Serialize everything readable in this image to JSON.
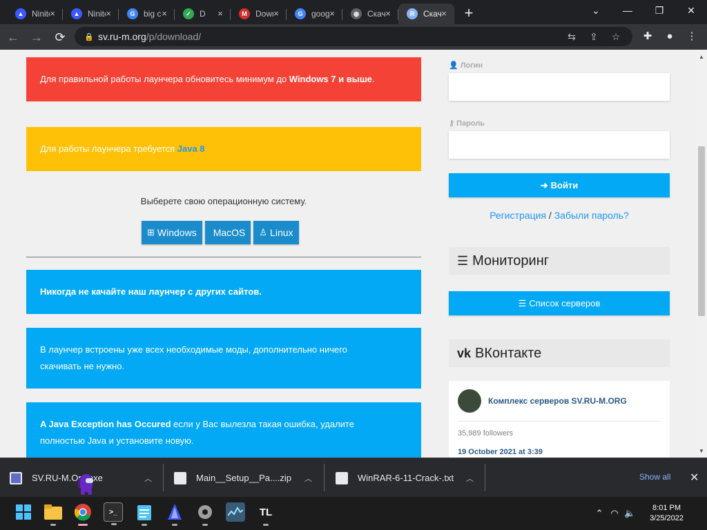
{
  "browser": {
    "tabs": [
      {
        "label": "Ninite",
        "favicon": "ninite-icon",
        "color": "#3d5afe",
        "active": false
      },
      {
        "label": "Ninite",
        "favicon": "ninite-icon",
        "color": "#3d5afe",
        "active": false
      },
      {
        "label": "big ch",
        "favicon": "google-icon",
        "color": "#4285f4",
        "active": false
      },
      {
        "label": "D",
        "favicon": "checkbox-icon",
        "color": "#34a853",
        "active": false
      },
      {
        "label": "Down",
        "favicon": "m-icon",
        "color": "#d32f2f",
        "active": false
      },
      {
        "label": "goog",
        "favicon": "google-icon",
        "color": "#4285f4",
        "active": false
      },
      {
        "label": "Скача",
        "favicon": "globe-icon",
        "color": "#5f6368",
        "active": false
      },
      {
        "label": "Скача",
        "favicon": "r-icon",
        "color": "#8ab4f8",
        "active": true
      }
    ],
    "url_host": "sv.ru-m.org",
    "url_path": "/p/download/"
  },
  "main": {
    "alert_red": {
      "text_before": "Для правильной работы лаунчера обновитесь минимум до ",
      "bold": "Windows 7 и выше",
      "text_after": "."
    },
    "alert_yellow": {
      "text_before": "Для работы лаунчера требуется ",
      "link": "Java 8"
    },
    "os_prompt": "Выберете свою операционную систему.",
    "os_buttons": [
      {
        "label": "Windows",
        "icon": "windows-icon"
      },
      {
        "label": "MacOS",
        "icon": "apple-icon"
      },
      {
        "label": "Linux",
        "icon": "linux-icon"
      }
    ],
    "notice1": "Никогда не качайте наш лаунчер с других сайтов.",
    "notice2_line1": "В лаунчер встроены уже всех необходимые моды, дополнительно ничего",
    "notice2_line2": "скачивать не нужно.",
    "notice3_bold": "A Java Exception has Occured",
    "notice3_line1": " если у Вас вылезла такая ошибка, удалите",
    "notice3_line2": "полностью Java и установите новую."
  },
  "sidebar": {
    "login_label": "Логин",
    "password_label": "Пароль",
    "login_button": "Войти",
    "register_link": "Регистрация",
    "separator": " / ",
    "forgot_link": "Забыли пароль?",
    "monitoring_title": "Мониторинг",
    "servers_button": "Список серверов",
    "vk_title": "ВКонтакте",
    "vk_group_name": "Комплекс серверов SV.RU-M.ORG",
    "vk_followers": "35,989 followers",
    "vk_date": "19 October 2021 at 3:39"
  },
  "downloads": {
    "items": [
      {
        "name": "SV.RU-M.Or...exe"
      },
      {
        "name": "Main__Setup__Pa....zip"
      },
      {
        "name": "WinRAR-6-11-Crack-.txt"
      }
    ],
    "show_all": "Show all"
  },
  "taskbar": {
    "time": "8:01 PM",
    "date": "3/25/2022",
    "tl_label": "TL"
  }
}
